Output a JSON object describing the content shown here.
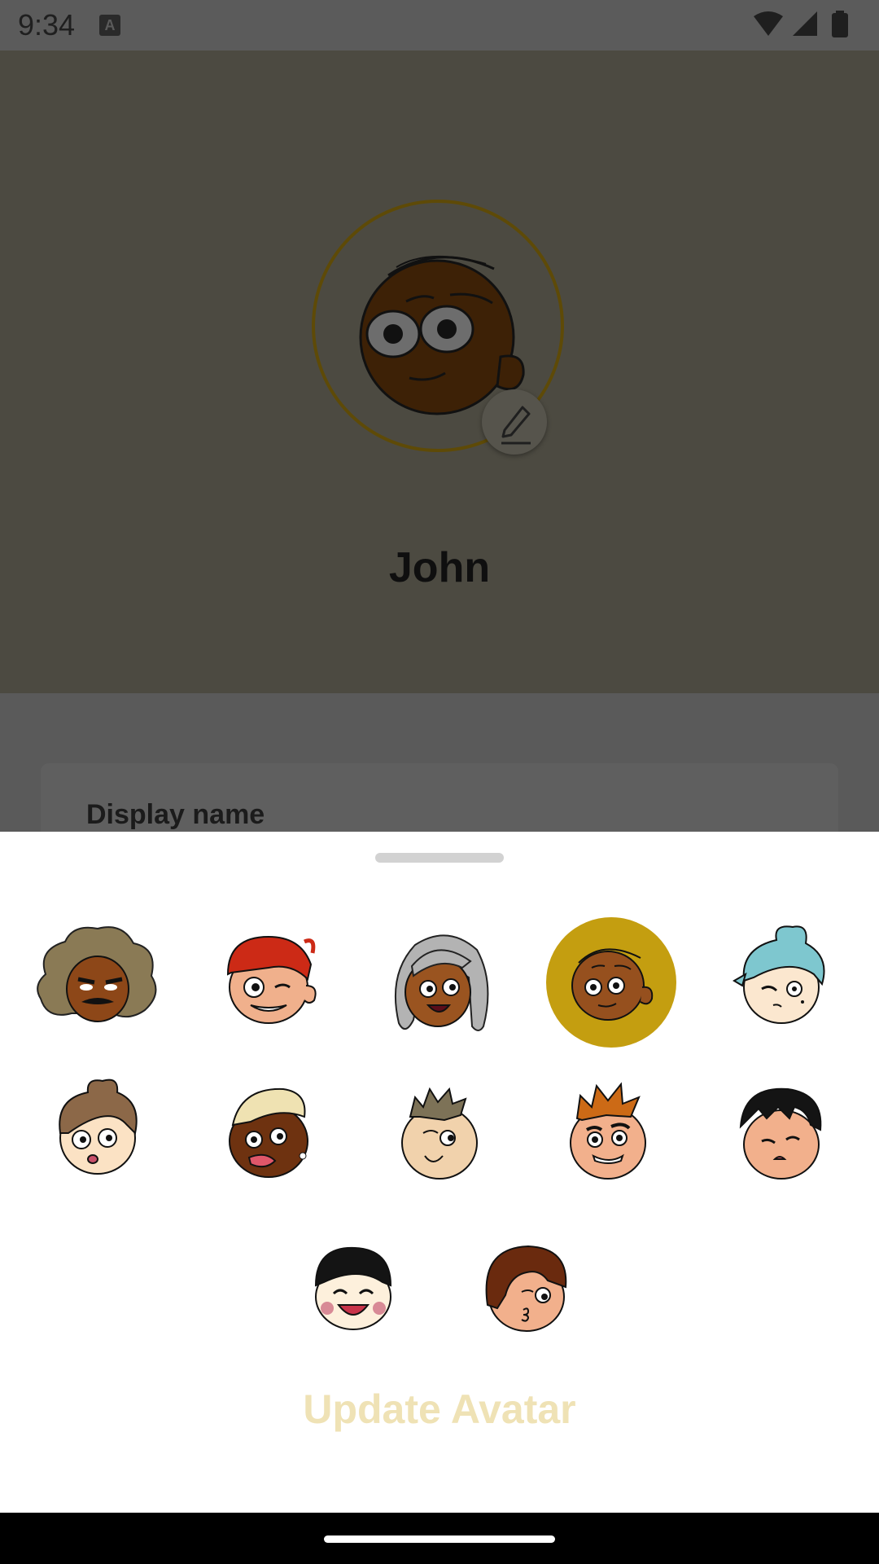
{
  "status_bar": {
    "time": "9:34",
    "notification_icon": "a-icon",
    "icons": [
      "wifi-icon",
      "signal-icon",
      "battery-icon"
    ]
  },
  "profile": {
    "name": "John",
    "edit_icon": "pencil-icon"
  },
  "card": {
    "display_name_label": "Display name"
  },
  "avatar_picker": {
    "selected_index": 3,
    "accent_color": "#c49e10",
    "avatars": [
      {
        "name": "avatar-curly-mustache"
      },
      {
        "name": "avatar-red-hair-wink"
      },
      {
        "name": "avatar-gray-hair"
      },
      {
        "name": "avatar-brown-boy"
      },
      {
        "name": "avatar-blue-bun"
      },
      {
        "name": "avatar-messy-bun"
      },
      {
        "name": "avatar-blonde-tongue"
      },
      {
        "name": "avatar-spiky-gray"
      },
      {
        "name": "avatar-spiky-orange"
      },
      {
        "name": "avatar-black-hair-cheeky"
      },
      {
        "name": "avatar-bangs-laughing"
      },
      {
        "name": "avatar-brown-bob-kiss"
      }
    ],
    "update_label": "Update Avatar"
  }
}
